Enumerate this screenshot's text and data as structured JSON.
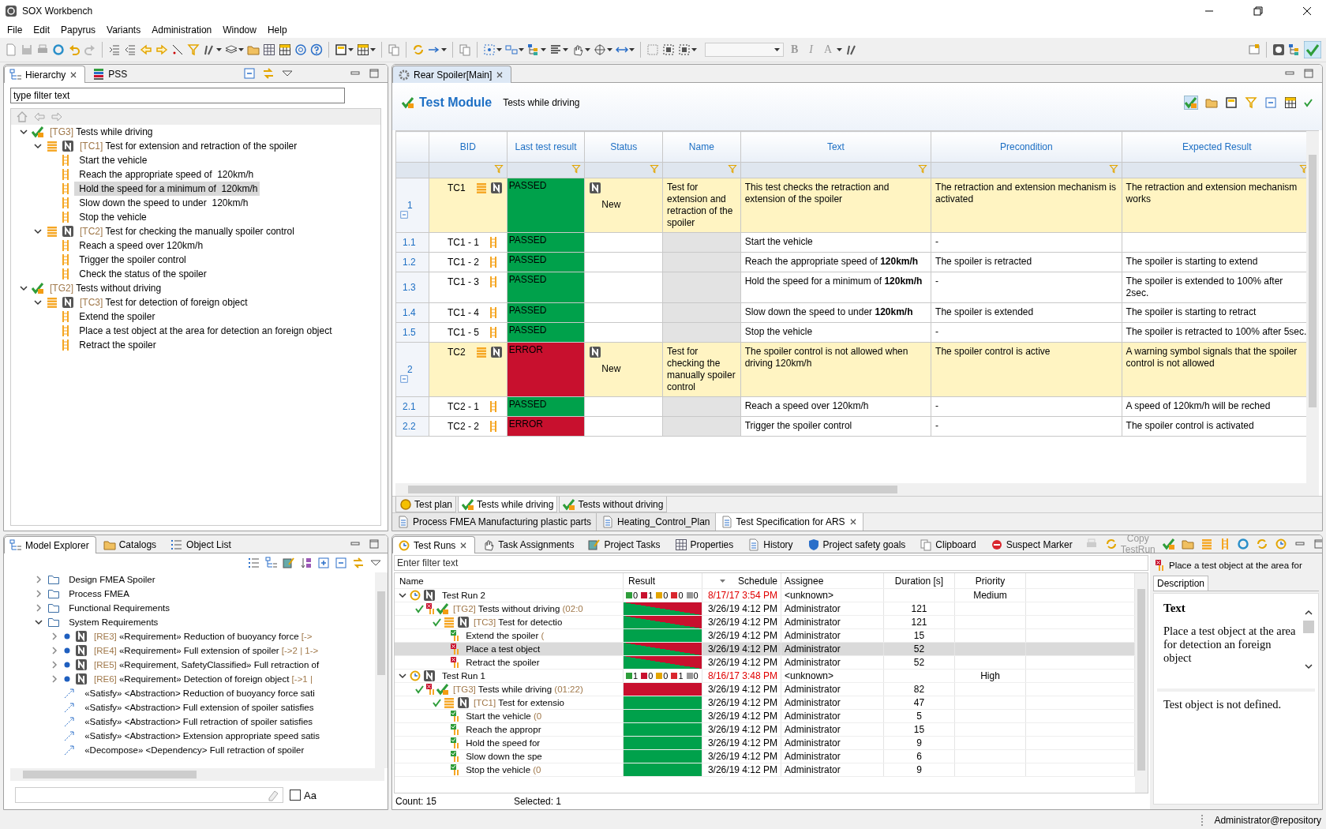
{
  "window": {
    "title": "SOX Workbench"
  },
  "menu": [
    "File",
    "Edit",
    "Papyrus",
    "Variants",
    "Administration",
    "Window",
    "Help"
  ],
  "toolbar": {
    "format_buttons": [
      "B",
      "I",
      "A"
    ]
  },
  "hierarchy": {
    "tabs": [
      {
        "label": "Hierarchy",
        "selected": true
      },
      {
        "label": "PSS",
        "selected": false
      }
    ],
    "filter": {
      "placeholder": "type filter text"
    },
    "tree": [
      {
        "kind": "group",
        "id": "[TG3]",
        "name": "Tests while driving",
        "expanded": true,
        "selected": false,
        "children": [
          {
            "kind": "case",
            "id": "[TC1]",
            "name": "Test for extension and retraction of the spoiler",
            "expanded": true,
            "selected": false,
            "children": [
              {
                "kind": "step",
                "name": "Start the vehicle",
                "selected": false
              },
              {
                "kind": "step",
                "name": "Reach the appropriate speed of  120km/h",
                "selected": false
              },
              {
                "kind": "step",
                "name": "Hold the speed for a minimum of  120km/h",
                "selected": true
              },
              {
                "kind": "step",
                "name": "Slow down the speed to under  120km/h",
                "selected": false
              },
              {
                "kind": "step",
                "name": "Stop the vehicle",
                "selected": false
              }
            ]
          },
          {
            "kind": "case",
            "id": "[TC2]",
            "name": "Test for checking the manually spoiler control",
            "expanded": true,
            "selected": false,
            "children": [
              {
                "kind": "step",
                "name": "Reach a speed over 120km/h",
                "selected": false
              },
              {
                "kind": "step",
                "name": "Trigger the spoiler control",
                "selected": false
              },
              {
                "kind": "step",
                "name": "Check the status of the spoiler",
                "selected": false
              }
            ]
          }
        ]
      },
      {
        "kind": "group",
        "id": "[TG2]",
        "name": "Tests without driving",
        "expanded": true,
        "selected": false,
        "children": [
          {
            "kind": "case",
            "id": "[TC3]",
            "name": "Test for detection of foreign object",
            "expanded": true,
            "selected": false,
            "children": [
              {
                "kind": "step",
                "name": "Extend the spoiler",
                "selected": false
              },
              {
                "kind": "step",
                "name": "Place a test object at the area for detection an foreign object",
                "selected": false
              },
              {
                "kind": "step",
                "name": "Retract the spoiler",
                "selected": false
              }
            ]
          }
        ]
      }
    ]
  },
  "editor": {
    "tabs": [
      {
        "label": "Rear Spoiler[Main]",
        "selected": true
      }
    ],
    "heading": "Test Module",
    "subtitle": "Tests while driving",
    "columns": [
      "BID",
      "Last test result",
      "Status",
      "Name",
      "Text",
      "Precondition",
      "Expected Result"
    ],
    "rows": [
      {
        "num": "1",
        "kind": "case",
        "expanded": true,
        "bid": "TC1",
        "result": {
          "label": "PASSED",
          "color": "#00a14b"
        },
        "status": "New",
        "name": "Test for extension and retraction of the spoiler",
        "text": "This test checks the retraction and extension of the spoiler",
        "precondition": "The retraction and extension mechanism is activated",
        "expected": "The retraction and extension mechanism works"
      },
      {
        "num": "1.1",
        "kind": "step",
        "bid": "TC1 - 1",
        "result": {
          "label": "PASSED",
          "color": "#00a14b"
        },
        "text": "Start the vehicle",
        "precondition": "-"
      },
      {
        "num": "1.2",
        "kind": "step",
        "bid": "TC1 - 2",
        "result": {
          "label": "PASSED",
          "color": "#00a14b"
        },
        "text": "Reach the appropriate speed of **120km/h**",
        "precondition": "The spoiler is retracted",
        "expected": "The spoiler is starting to extend"
      },
      {
        "num": "1.3",
        "kind": "step",
        "bid": "TC1 - 3",
        "result": {
          "label": "PASSED",
          "color": "#00a14b"
        },
        "text": "Hold the speed for a minimum of **120km/h**",
        "precondition": "-",
        "expected": "The spoiler is extended to 100% after 2sec."
      },
      {
        "num": "1.4",
        "kind": "step",
        "bid": "TC1 - 4",
        "result": {
          "label": "PASSED",
          "color": "#00a14b"
        },
        "text": "Slow down the speed to under **120km/h**",
        "precondition": "The spoiler is extended",
        "expected": "The spoiler is starting to retract"
      },
      {
        "num": "1.5",
        "kind": "step",
        "bid": "TC1 - 5",
        "result": {
          "label": "PASSED",
          "color": "#00a14b"
        },
        "text": "Stop the vehicle",
        "precondition": "-",
        "expected": "The spoiler is retracted to 100% after 5sec."
      },
      {
        "num": "2",
        "kind": "case",
        "expanded": true,
        "bid": "TC2",
        "result": {
          "label": "ERROR",
          "color": "#c8102e"
        },
        "status": "New",
        "name": "Test for checking the manually spoiler control",
        "text": "The spoiler control is not allowed when driving 120km/h",
        "precondition": "The spoiler control is active",
        "expected": "A warning symbol signals that the spoiler control is not allowed"
      },
      {
        "num": "2.1",
        "kind": "step",
        "bid": "TC2 - 1",
        "result": {
          "label": "PASSED",
          "color": "#00a14b"
        },
        "text": "Reach a speed over 120km/h",
        "precondition": "-",
        "expected": "A speed of 120km/h will be reched"
      },
      {
        "num": "2.2",
        "kind": "step",
        "bid": "TC2 - 2",
        "result": {
          "label": "ERROR",
          "color": "#c8102e"
        },
        "text": "Trigger the spoiler control",
        "precondition": "-",
        "expected": "The spoiler control is activated"
      }
    ],
    "sheet_tabs": [
      {
        "label": "Test plan",
        "kind": "plan",
        "selected": false
      },
      {
        "label": "Tests while driving",
        "kind": "group",
        "selected": true
      },
      {
        "label": "Tests without driving",
        "kind": "group",
        "selected": false
      }
    ],
    "document_tabs": [
      {
        "label": "Process FMEA Manufacturing plastic parts",
        "selected": false
      },
      {
        "label": "Heating_Control_Plan",
        "selected": false
      },
      {
        "label": "Test Specification for ARS",
        "selected": true
      }
    ]
  },
  "model_explorer": {
    "tabs": [
      {
        "label": "Model Explorer",
        "selected": true
      },
      {
        "label": "Catalogs",
        "selected": false
      },
      {
        "label": "Object List",
        "selected": false
      }
    ],
    "tree": [
      {
        "kind": "folder",
        "text": "Design FMEA Spoiler",
        "expanded": false
      },
      {
        "kind": "folder",
        "text": "Process FMEA",
        "expanded": false
      },
      {
        "kind": "folder",
        "text": "Functional Requirements",
        "expanded": false
      },
      {
        "kind": "folder",
        "text": "System Requirements",
        "expanded": true,
        "children": [
          {
            "kind": "requirement",
            "id": "[RE3]",
            "text": "«Requirement» Reduction of buoyancy force",
            "trace": "[->",
            "expanded": false
          },
          {
            "kind": "requirement",
            "id": "[RE4]",
            "text": "«Requirement» Full extension of spoiler",
            "trace": "[->2 | 1->",
            "expanded": false
          },
          {
            "kind": "requirement",
            "id": "[RE5]",
            "text": "«Requirement, SafetyClassified» Full retraction of",
            "expanded": false
          },
          {
            "kind": "requirement",
            "id": "[RE6]",
            "text": "«Requirement» Detection of foreign object",
            "trace": "[->1 |",
            "expanded": false
          },
          {
            "kind": "satisfy",
            "text": "«Satisfy» <Abstraction> Reduction of buoyancy force sati"
          },
          {
            "kind": "satisfy",
            "text": "«Satisfy» <Abstraction> Full extension of spoiler satisfies"
          },
          {
            "kind": "satisfy",
            "text": "«Satisfy» <Abstraction> Full retraction of spoiler satisfies"
          },
          {
            "kind": "satisfy",
            "text": "«Satisfy» <Abstraction> Extension appropriate speed satis"
          },
          {
            "kind": "decompose",
            "text": "«Decompose» <Dependency> Full retraction of spoiler"
          }
        ]
      }
    ],
    "case_toggle": {
      "label": "Aa",
      "checked": false
    }
  },
  "test_runs": {
    "tabs": [
      {
        "label": "Test Runs",
        "selected": true
      },
      {
        "label": "Task Assignments",
        "selected": false
      },
      {
        "label": "Project Tasks",
        "selected": false
      },
      {
        "label": "Properties",
        "selected": false
      },
      {
        "label": "History",
        "selected": false
      },
      {
        "label": "Project safety goals",
        "selected": false
      },
      {
        "label": "Clipboard",
        "selected": false
      },
      {
        "label": "Suspect Marker",
        "selected": false
      }
    ],
    "action": {
      "label": "Copy TestRun",
      "disabled": true
    },
    "filter": {
      "placeholder": "Enter filter text"
    },
    "columns": [
      "Name",
      "Result",
      "Schedule",
      "Assignee",
      "Duration [s]",
      "Priority"
    ],
    "rows": [
      {
        "kind": "run",
        "name": "Test Run 2",
        "expanded": true,
        "selected": false,
        "counts": [
          {
            "kind": "passed",
            "value": "0"
          },
          {
            "kind": "failed",
            "value": "1"
          },
          {
            "kind": "blocked",
            "value": "0"
          },
          {
            "kind": "error",
            "value": "0"
          },
          {
            "kind": "skipped",
            "value": "0"
          }
        ],
        "schedule": "8/17/17 3:54 PM",
        "overdue": true,
        "assignee": "<unknown>",
        "priority": "Medium",
        "children": [
          {
            "kind": "group",
            "id": "[TG2]",
            "name": "Tests without driving",
            "time": "(02:0",
            "result": {
              "kind": "mixed"
            },
            "selected": false,
            "schedule": "3/26/19 4:12 PM",
            "overdue": false,
            "assignee": "Administrator",
            "duration": "121",
            "children": [
              {
                "kind": "case",
                "id": "[TC3]",
                "name": "Test for detectio",
                "result": {
                  "kind": "mixed"
                },
                "selected": false,
                "schedule": "3/26/19 4:12 PM",
                "overdue": false,
                "assignee": "Administrator",
                "duration": "121",
                "children": [
                  {
                    "kind": "step",
                    "name": "Extend the spoiler",
                    "time": "(",
                    "result": {
                      "kind": "passed"
                    },
                    "selected": false,
                    "schedule": "3/26/19 4:12 PM",
                    "overdue": false,
                    "assignee": "Administrator",
                    "duration": "15"
                  },
                  {
                    "kind": "step",
                    "name": "Place a test object",
                    "result": {
                      "kind": "mixed"
                    },
                    "selected": true,
                    "schedule": "3/26/19 4:12 PM",
                    "overdue": false,
                    "assignee": "Administrator",
                    "duration": "52"
                  },
                  {
                    "kind": "step",
                    "name": "Retract the spoiler",
                    "result": {
                      "kind": "mixed"
                    },
                    "selected": false,
                    "schedule": "3/26/19 4:12 PM",
                    "overdue": false,
                    "assignee": "Administrator",
                    "duration": "52"
                  }
                ]
              }
            ]
          }
        ]
      },
      {
        "kind": "run",
        "name": "Test Run 1",
        "expanded": true,
        "selected": false,
        "counts": [
          {
            "kind": "passed",
            "value": "1"
          },
          {
            "kind": "failed",
            "value": "0"
          },
          {
            "kind": "blocked",
            "value": "0"
          },
          {
            "kind": "error",
            "value": "1"
          },
          {
            "kind": "skipped",
            "value": "0"
          }
        ],
        "schedule": "8/16/17 3:48 PM",
        "overdue": true,
        "assignee": "<unknown>",
        "priority": "High",
        "children": [
          {
            "kind": "group",
            "id": "[TG3]",
            "name": "Tests while driving",
            "time": "(01:22)",
            "result": {
              "kind": "failed"
            },
            "selected": false,
            "schedule": "3/26/19 4:12 PM",
            "overdue": false,
            "assignee": "Administrator",
            "duration": "82",
            "children": [
              {
                "kind": "case",
                "id": "[TC1]",
                "name": "Test for extensio",
                "result": {
                  "kind": "passed"
                },
                "selected": false,
                "schedule": "3/26/19 4:12 PM",
                "overdue": false,
                "assignee": "Administrator",
                "duration": "47",
                "children": [
                  {
                    "kind": "step",
                    "name": "Start the vehicle",
                    "time": "(0",
                    "result": {
                      "kind": "passed"
                    },
                    "selected": false,
                    "schedule": "3/26/19 4:12 PM",
                    "overdue": false,
                    "assignee": "Administrator",
                    "duration": "5"
                  },
                  {
                    "kind": "step",
                    "name": "Reach the appropr",
                    "result": {
                      "kind": "passed"
                    },
                    "selected": false,
                    "schedule": "3/26/19 4:12 PM",
                    "overdue": false,
                    "assignee": "Administrator",
                    "duration": "15"
                  },
                  {
                    "kind": "step",
                    "name": "Hold the speed for",
                    "result": {
                      "kind": "passed"
                    },
                    "selected": false,
                    "schedule": "3/26/19 4:12 PM",
                    "overdue": false,
                    "assignee": "Administrator",
                    "duration": "9"
                  },
                  {
                    "kind": "step",
                    "name": "Slow down the spe",
                    "result": {
                      "kind": "passed"
                    },
                    "selected": false,
                    "schedule": "3/26/19 4:12 PM",
                    "overdue": false,
                    "assignee": "Administrator",
                    "duration": "6"
                  },
                  {
                    "kind": "step",
                    "name": "Stop the vehicle",
                    "time": "(0",
                    "result": {
                      "kind": "passed"
                    },
                    "selected": false,
                    "schedule": "3/26/19 4:12 PM",
                    "overdue": false,
                    "assignee": "Administrator",
                    "duration": "9"
                  }
                ]
              }
            ]
          }
        ]
      }
    ],
    "footer": {
      "count": "Count: 15",
      "selected": "Selected: 1"
    },
    "details": {
      "title": "Place a test object at the area for",
      "tabs": [
        {
          "label": "Description",
          "selected": true
        }
      ],
      "heading": "Text",
      "body": "Place a test object at the area for detection an foreign object",
      "note": "Test object is not defined."
    }
  },
  "status_bar": {
    "user": "Administrator@repository"
  }
}
